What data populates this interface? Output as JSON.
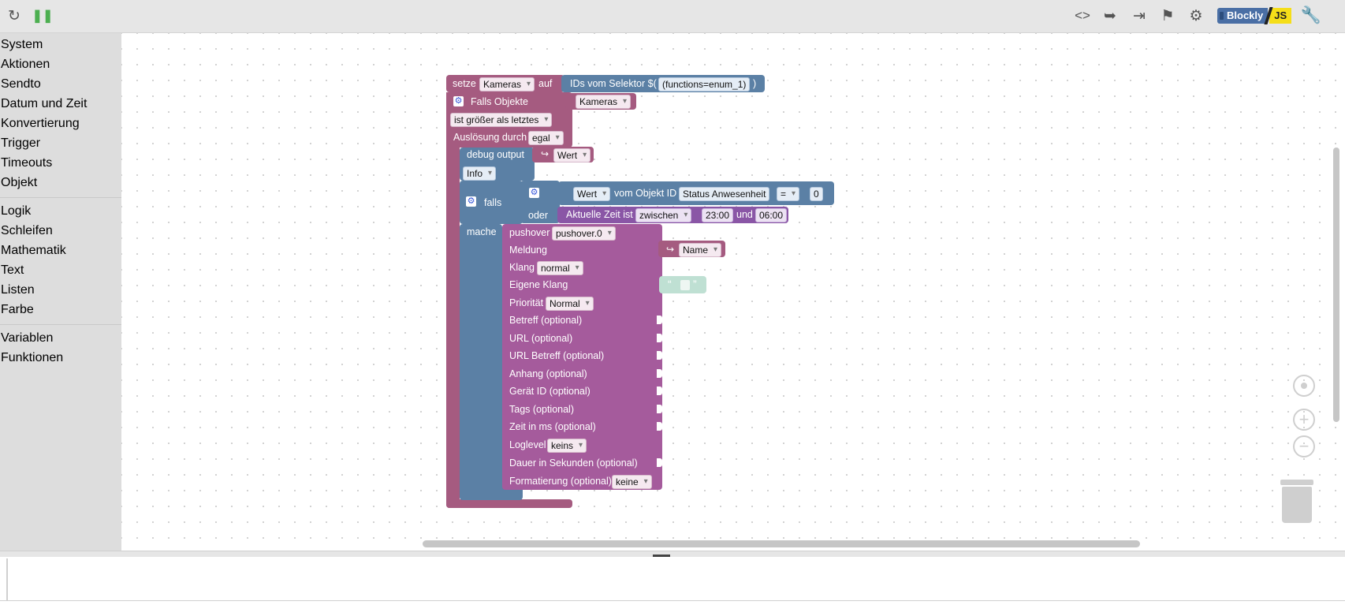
{
  "toolbar": {
    "left_icons": [
      "refresh-icon",
      "pause-icon"
    ],
    "right_icons": [
      "code-icon",
      "export-icon",
      "import-icon",
      "checkered-flag-icon",
      "gear-icon",
      "wrench-icon"
    ],
    "logo": {
      "blockly": "Blockly",
      "js": "JS"
    },
    "colors": {
      "pause": "#4caf50",
      "blockly": "#4a6fa5",
      "js": "#f5de19"
    }
  },
  "sidebar": {
    "groups": [
      [
        "System",
        "Aktionen",
        "Sendto",
        "Datum und Zeit",
        "Konvertierung",
        "Trigger",
        "Timeouts",
        "Objekt"
      ],
      [
        "Logik",
        "Schleifen",
        "Mathematik",
        "Text",
        "Listen",
        "Farbe"
      ],
      [
        "Variablen",
        "Funktionen"
      ]
    ]
  },
  "blocks": {
    "set_var": {
      "label_set": "setze",
      "var": "Kameras",
      "label_to": "auf",
      "selector_label": "IDs vom Selektor $(",
      "selector_value": "(functions=enum_1)",
      "selector_close": ")"
    },
    "trigger": {
      "label": "Falls Objekte",
      "objects": "Kameras",
      "condition": "ist größer als letztes",
      "ack_label": "Auslösung durch",
      "ack_value": "egal"
    },
    "debug": {
      "label": "debug output",
      "value": "Wert",
      "level": "Info"
    },
    "if_block": {
      "if_label": "falls",
      "or_label": "oder",
      "do_label": "mache"
    },
    "compare": {
      "value": "Wert",
      "label": "vom Objekt ID",
      "object": "Status Anwesenheit",
      "operator": "=",
      "number": "0"
    },
    "time_check": {
      "label": "Aktuelle Zeit ist",
      "mode": "zwischen",
      "start": "23:00",
      "and_label": "und",
      "end": "06:00"
    },
    "pushover": {
      "label": "pushover",
      "instance": "pushover.0",
      "message_label": "Meldung",
      "message_value": "Name",
      "sound_label": "Klang",
      "sound_value": "normal",
      "own_sound_label": "Eigene Klang",
      "text_open_quote": "“",
      "text_close_quote": "”",
      "priority_label": "Priorität",
      "priority_value": "Normal",
      "subject": "Betreff (optional)",
      "url": "URL (optional)",
      "url_subject": "URL Betreff (optional)",
      "attachment": "Anhang (optional)",
      "device": "Gerät ID (optional)",
      "tags": "Tags (optional)",
      "time_ms": "Zeit in ms (optional)",
      "loglevel_label": "Loglevel",
      "loglevel_value": "keins",
      "duration": "Dauer in Sekunden (optional)",
      "format_label": "Formatierung (optional)",
      "format_value": "keine"
    }
  },
  "workspace_controls": [
    "recenter-icon",
    "zoom-in-icon",
    "zoom-out-icon",
    "trash-icon"
  ]
}
